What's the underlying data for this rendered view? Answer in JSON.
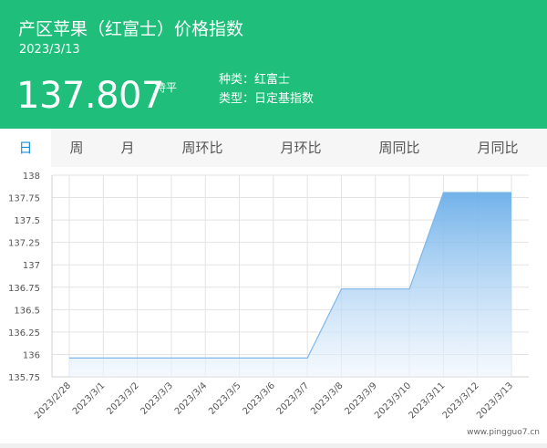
{
  "header": {
    "title": "产区苹果（红富士）价格指数",
    "date": "2023/3/13",
    "price": "137.807",
    "change": "持平",
    "variety_label": "种类：",
    "variety": "红富士",
    "type_label": "类型：",
    "type": "日定基指数"
  },
  "tabs": [
    {
      "label": "日",
      "active": true
    },
    {
      "label": "周",
      "active": false
    },
    {
      "label": "月",
      "active": false
    },
    {
      "label": "周环比",
      "active": false
    },
    {
      "label": "月环比",
      "active": false
    },
    {
      "label": "周同比",
      "active": false
    },
    {
      "label": "月同比",
      "active": false
    }
  ],
  "watermark": "www.pingguo7.cn",
  "colors": {
    "header_bg": "#1fbf7b",
    "active_tab_text": "#1a8fd8",
    "line": "#7fb7ea",
    "area_top": "#6aaee9",
    "area_bottom": "#eef5fd"
  },
  "chart_data": {
    "type": "area",
    "title": "",
    "xlabel": "",
    "ylabel": "",
    "x": [
      "2023/2/28",
      "2023/3/1",
      "2023/3/2",
      "2023/3/3",
      "2023/3/4",
      "2023/3/5",
      "2023/3/6",
      "2023/3/7",
      "2023/3/8",
      "2023/3/9",
      "2023/3/10",
      "2023/3/11",
      "2023/3/12",
      "2023/3/13"
    ],
    "series": [
      {
        "values": [
          135.96,
          135.96,
          135.96,
          135.96,
          135.96,
          135.96,
          135.96,
          135.96,
          136.73,
          136.73,
          136.73,
          137.807,
          137.807,
          137.807
        ]
      }
    ],
    "yticks": [
      "138",
      "137.75",
      "137.5",
      "137.25",
      "137",
      "136.75",
      "136.5",
      "136.25",
      "136",
      "135.75"
    ],
    "ylim": [
      135.75,
      138
    ],
    "grid": true
  }
}
